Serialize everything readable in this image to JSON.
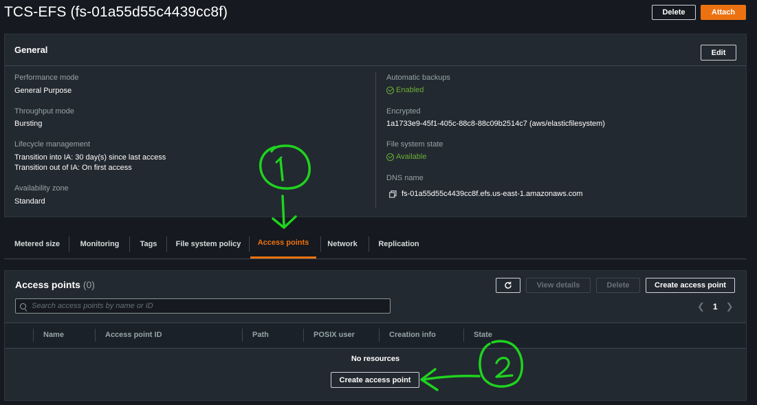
{
  "header": {
    "title": "TCS-EFS (fs-01a55d55c4439cc8f)",
    "delete_label": "Delete",
    "attach_label": "Attach"
  },
  "general": {
    "title": "General",
    "edit_label": "Edit",
    "performance_mode": {
      "label": "Performance mode",
      "value": "General Purpose"
    },
    "throughput_mode": {
      "label": "Throughput mode",
      "value": "Bursting"
    },
    "lifecycle": {
      "label": "Lifecycle management",
      "value_1": "Transition into IA: 30 day(s) since last access",
      "value_2": "Transition out of IA: On first access"
    },
    "availability_zone": {
      "label": "Availability zone",
      "value": "Standard"
    },
    "automatic_backups": {
      "label": "Automatic backups",
      "value": "Enabled"
    },
    "encrypted": {
      "label": "Encrypted",
      "value": "1a1733e9-45f1-405c-88c8-88c09b2514c7 (aws/elasticfilesystem)"
    },
    "file_system_state": {
      "label": "File system state",
      "value": "Available"
    },
    "dns_name": {
      "label": "DNS name",
      "value": "fs-01a55d55c4439cc8f.efs.us-east-1.amazonaws.com"
    }
  },
  "tabs": [
    {
      "label": "Metered size"
    },
    {
      "label": "Monitoring"
    },
    {
      "label": "Tags"
    },
    {
      "label": "File system policy"
    },
    {
      "label": "Access points"
    },
    {
      "label": "Network"
    },
    {
      "label": "Replication"
    }
  ],
  "access_points": {
    "title": "Access points",
    "count": "(0)",
    "view_details_label": "View details",
    "delete_label": "Delete",
    "create_label": "Create access point",
    "search_placeholder": "Search access points by name or ID",
    "page_number": "1",
    "columns": [
      "Name",
      "Access point ID",
      "Path",
      "POSIX user",
      "Creation info",
      "State"
    ],
    "empty_text": "No resources",
    "empty_create_label": "Create access point"
  },
  "annotations": {
    "marker_1": "1",
    "marker_2": "2",
    "color": "#1fd31f"
  },
  "colors": {
    "accent": "#ec7211",
    "success": "#6aaf35",
    "background": "#16191f",
    "panel": "#232930"
  }
}
